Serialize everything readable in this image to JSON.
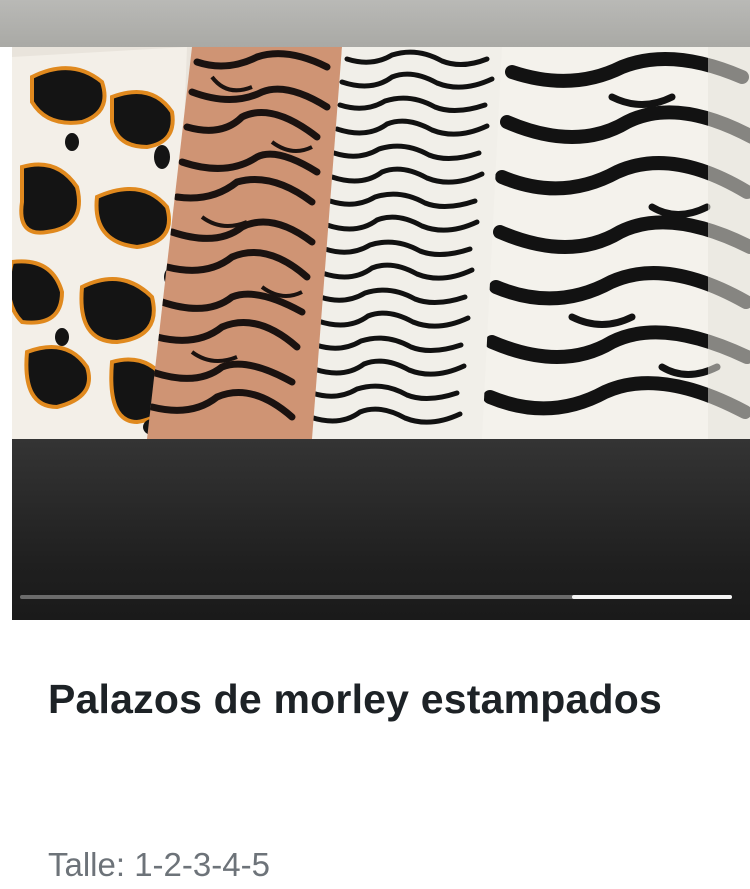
{
  "product": {
    "title": "Palazos de morley estampados",
    "size_text": "Talle: 1-2-3-4-5"
  },
  "media": {
    "image_subject": "four printed ribbed knit palazzo pants",
    "progress_start": 0.775,
    "progress_end": 1.0,
    "colors": {
      "progress_track": "#6b6b6b",
      "progress_fill": "#f4f4f4",
      "video_background": "#1c1c1c"
    }
  },
  "colors": {
    "title": "#1d2226",
    "subtitle": "#6d7379",
    "background": "#ffffff"
  }
}
